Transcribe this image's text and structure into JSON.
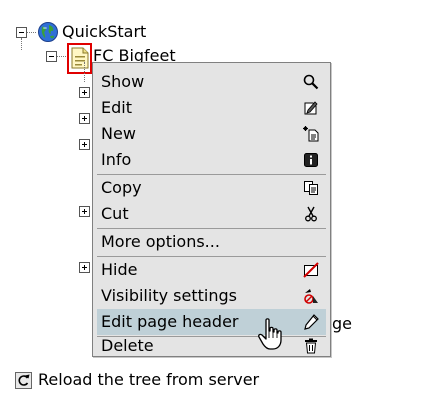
{
  "tree": {
    "root_label": "QuickStart",
    "child_label": "FC Bigfeet",
    "obscured_suffix": "ge",
    "reload_label": "Reload the tree from server"
  },
  "context_menu": {
    "items": [
      {
        "label": "Show",
        "icon": "magnifier-icon"
      },
      {
        "label": "Edit",
        "icon": "edit-icon"
      },
      {
        "label": "New",
        "icon": "new-icon"
      },
      {
        "label": "Info",
        "icon": "info-icon"
      },
      {
        "label": "Copy",
        "icon": "copy-icon"
      },
      {
        "label": "Cut",
        "icon": "scissors-icon"
      },
      {
        "label": "More options..."
      },
      {
        "label": "Hide",
        "icon": "hide-icon"
      },
      {
        "label": "Visibility settings",
        "icon": "visibility-icon"
      },
      {
        "label": "Edit page header",
        "icon": "pen-icon",
        "highlighted": true
      },
      {
        "label": "Delete",
        "icon": "trash-icon"
      }
    ]
  },
  "colors": {
    "menu_bg": "#e4e4e4",
    "highlight": "#bfd0d7",
    "selection_border": "#e00000"
  }
}
